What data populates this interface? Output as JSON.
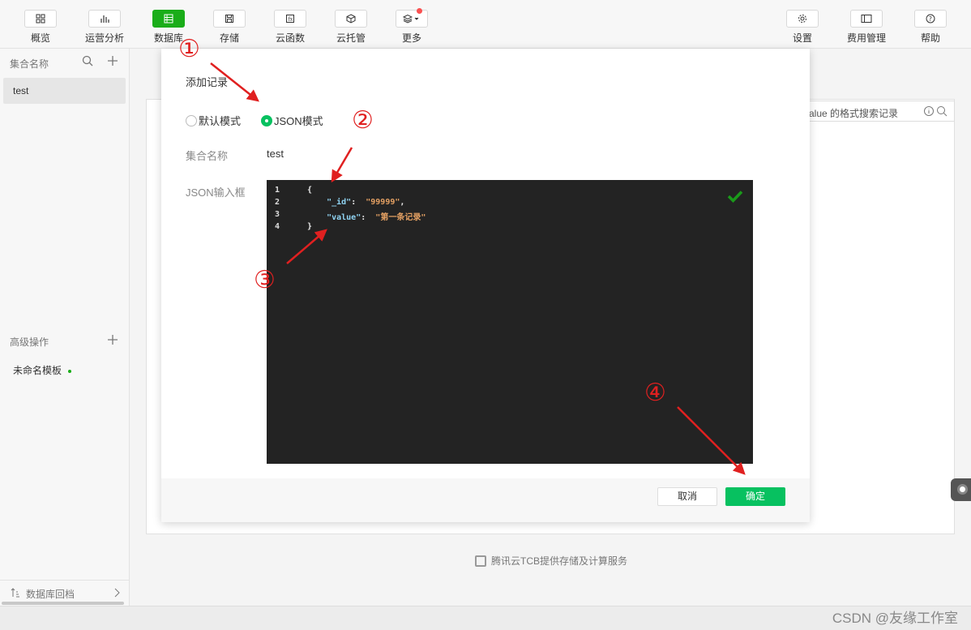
{
  "toolbar": {
    "items": [
      {
        "label": "概览",
        "icon": "overview-grid-icon"
      },
      {
        "label": "运营分析",
        "icon": "bar-chart-icon"
      },
      {
        "label": "数据库",
        "icon": "database-table-icon"
      },
      {
        "label": "存储",
        "icon": "storage-floppy-icon"
      },
      {
        "label": "云函数",
        "icon": "cloud-function-icon"
      },
      {
        "label": "云托管",
        "icon": "cube-icon"
      },
      {
        "label": "更多",
        "icon": "layers-icon"
      }
    ],
    "right_items": [
      {
        "label": "设置",
        "icon": "gear-icon"
      },
      {
        "label": "费用管理",
        "icon": "billing-panel-icon"
      },
      {
        "label": "帮助",
        "icon": "question-icon"
      }
    ],
    "active_color": "#1aad19"
  },
  "sidebar": {
    "collections_header": "集合名称",
    "collections": [
      "test"
    ],
    "advanced_header": "高级操作",
    "template_item": "未命名模板",
    "bottom_link": "数据库回档"
  },
  "main": {
    "search_placeholder_fragment": "alue 的格式搜索记录",
    "footer_note": "腾讯云TCB提供存储及计算服务"
  },
  "modal": {
    "title": "添加记录",
    "mode_default": "默认模式",
    "mode_json": "JSON模式",
    "selected_mode": "JSON模式",
    "collection_label": "集合名称",
    "collection_value": "test",
    "json_label": "JSON输入框",
    "editor_lines": [
      {
        "num": "1",
        "parts": [
          {
            "t": "{",
            "c": "plain"
          }
        ]
      },
      {
        "num": "2",
        "parts": [
          {
            "t": "    \"_id\"",
            "c": "key"
          },
          {
            "t": ":  ",
            "c": "plain"
          },
          {
            "t": "\"99999\"",
            "c": "str"
          },
          {
            "t": ",",
            "c": "plain"
          }
        ]
      },
      {
        "num": "3",
        "parts": [
          {
            "t": "    \"value\"",
            "c": "key"
          },
          {
            "t": ":  ",
            "c": "plain"
          },
          {
            "t": "\"第一条记录\"",
            "c": "str"
          }
        ]
      },
      {
        "num": "4",
        "parts": [
          {
            "t": "}",
            "c": "plain"
          }
        ]
      }
    ],
    "cancel_label": "取消",
    "ok_label": "确定",
    "accent_color": "#07c160"
  },
  "annotations": [
    "①",
    "②",
    "③",
    "④"
  ],
  "watermark": "CSDN @友缘工作室"
}
